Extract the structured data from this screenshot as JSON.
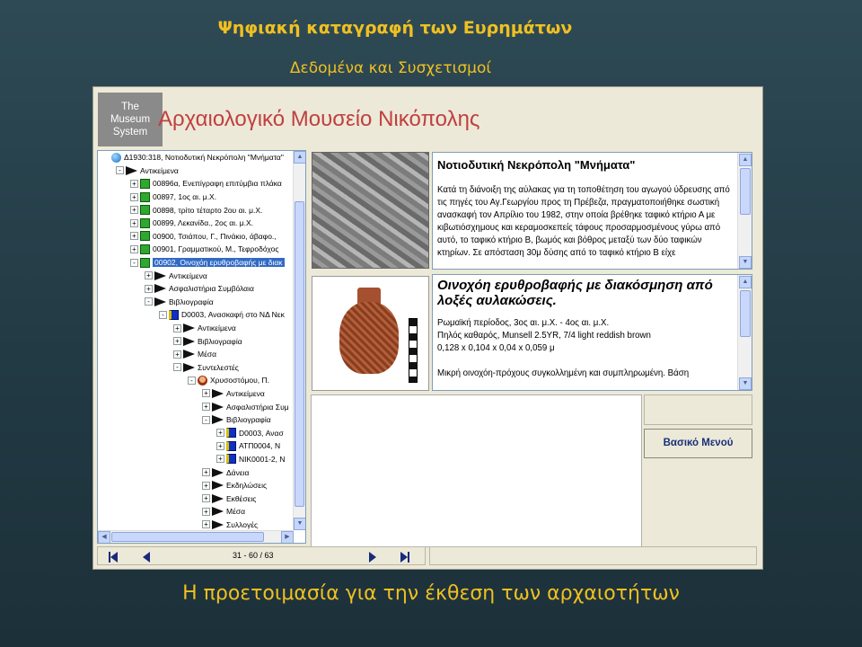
{
  "slide": {
    "title": "Ψηφιακή καταγραφή των Ευρημάτων",
    "subtitle": "Δεδομένα και Συσχετισμοί",
    "caption": "Η προετοιμασία για την έκθεση των αρχαιοτήτων"
  },
  "app": {
    "logo_lines": [
      "The",
      "Museum",
      "System"
    ],
    "museum_name": "Αρχαιολογικό Μουσείο Νικόπολης"
  },
  "tree": {
    "items": [
      {
        "indent": 0,
        "exp": "",
        "icon": "globe",
        "label": "Δ1930:318, Νοτιοδυτική Νεκρόπολη \"Μνήματα\"",
        "sel": false
      },
      {
        "indent": 1,
        "exp": "-",
        "icon": "arrow",
        "label": "Αντικείμενα",
        "sel": false
      },
      {
        "indent": 2,
        "exp": "+",
        "icon": "item",
        "label": "00896α, Ενεπίγραφη επιτύμβια πλάκα",
        "sel": false
      },
      {
        "indent": 2,
        "exp": "+",
        "icon": "item",
        "label": "00897, 1ος αι. μ.Χ.",
        "sel": false
      },
      {
        "indent": 2,
        "exp": "+",
        "icon": "item",
        "label": "00898, τρίτο τέταρτο 2ου αι. μ.Χ.",
        "sel": false
      },
      {
        "indent": 2,
        "exp": "+",
        "icon": "item",
        "label": "00899, Λεκανίδα., 2ος αι. μ.Χ.",
        "sel": false
      },
      {
        "indent": 2,
        "exp": "+",
        "icon": "item",
        "label": "00900, Τσιάπου, Γ., Πινάκιο, άβαφο.,",
        "sel": false
      },
      {
        "indent": 2,
        "exp": "+",
        "icon": "item",
        "label": "00901, Γραμματικού, Μ., Τεφροδόχος",
        "sel": false
      },
      {
        "indent": 2,
        "exp": "-",
        "icon": "item",
        "label": "00902, Οινοχόη ερυθροβαφής με διακ",
        "sel": true
      },
      {
        "indent": 3,
        "exp": "+",
        "icon": "arrow",
        "label": "Αντικείμενα",
        "sel": false
      },
      {
        "indent": 3,
        "exp": "+",
        "icon": "arrow",
        "label": "Ασφαλιστήρια Συμβόλαια",
        "sel": false
      },
      {
        "indent": 3,
        "exp": "-",
        "icon": "arrow",
        "label": "Βιβλιογραφία",
        "sel": false
      },
      {
        "indent": 4,
        "exp": "-",
        "icon": "book",
        "label": "D0003, Ανασκαφή στο ΝΔ Νεκ",
        "sel": false
      },
      {
        "indent": 5,
        "exp": "+",
        "icon": "arrow",
        "label": "Αντικείμενα",
        "sel": false
      },
      {
        "indent": 5,
        "exp": "+",
        "icon": "arrow",
        "label": "Βιβλιογραφία",
        "sel": false
      },
      {
        "indent": 5,
        "exp": "+",
        "icon": "arrow",
        "label": "Μέσα",
        "sel": false
      },
      {
        "indent": 5,
        "exp": "-",
        "icon": "arrow",
        "label": "Συντελεστές",
        "sel": false
      },
      {
        "indent": 6,
        "exp": "-",
        "icon": "person",
        "label": "Χρυσοστόμου, Π.",
        "sel": false
      },
      {
        "indent": 7,
        "exp": "+",
        "icon": "arrow",
        "label": "Αντικείμενα",
        "sel": false
      },
      {
        "indent": 7,
        "exp": "+",
        "icon": "arrow",
        "label": "Ασφαλιστήρια Συμ",
        "sel": false
      },
      {
        "indent": 7,
        "exp": "-",
        "icon": "arrow",
        "label": "Βιβλιογραφία",
        "sel": false
      },
      {
        "indent": 8,
        "exp": "+",
        "icon": "book",
        "label": "D0003, Ανασ",
        "sel": false
      },
      {
        "indent": 8,
        "exp": "+",
        "icon": "book",
        "label": "ΑΤΠ0004, Ν",
        "sel": false
      },
      {
        "indent": 8,
        "exp": "+",
        "icon": "book",
        "label": "ΝΙΚ0001-2, Ν",
        "sel": false
      },
      {
        "indent": 7,
        "exp": "+",
        "icon": "arrow",
        "label": "Δάνεια",
        "sel": false
      },
      {
        "indent": 7,
        "exp": "+",
        "icon": "arrow",
        "label": "Εκδηλώσεις",
        "sel": false
      },
      {
        "indent": 7,
        "exp": "+",
        "icon": "arrow",
        "label": "Εκθέσεις",
        "sel": false
      },
      {
        "indent": 7,
        "exp": "+",
        "icon": "arrow",
        "label": "Μέσα",
        "sel": false
      },
      {
        "indent": 7,
        "exp": "+",
        "icon": "arrow",
        "label": "Συλλογές",
        "sel": false
      }
    ]
  },
  "panel1": {
    "title": "Νοτιοδυτική Νεκρόπολη \"Μνήματα\"",
    "text": "Κατά τη διάνοιξη της αύλακας για τη τοποθέτηση του αγωγού ύδρευσης από τις πηγές του Αγ.Γεωργίου προς τη Πρέβεζα, πραγματοποιήθηκε σωστική ανασκαφή τον Απρίλιο του 1982, στην οποία βρέθηκε ταφικό κτήριο Α με κιβωτιόσχημους και κεραμοσκεπείς τάφους προσαρμοσμένους γύρω από αυτό, το ταφικό κτήριο Β, βωμός και βόθρος μεταξύ των δύο ταφικών κτηρίων. Σε απόσταση 30μ δύσης από το ταφικό κτήριο Β είχε"
  },
  "panel2": {
    "title": "Οινοχόη ερυθροβαφής με διακόσμηση από λοξές αυλακώσεις.",
    "lines": [
      "Ρωμαϊκή περίοδος, 3ος αι. μ.Χ. - 4ος αι. μ.Χ.",
      "Πηλός καθαρός, Munsell 2.5YR, 7/4 light reddish brown",
      "0,128 x 0,104 x 0,04 x 0,059 μ"
    ],
    "extra": "Μικρή οινοχόη-πρόχους συγκολλημένη και συμπληρωμένη. Βάση"
  },
  "buttons": {
    "main_menu": "Βασικό Μενού"
  },
  "nav": {
    "count": "31 - 60 / 63"
  }
}
